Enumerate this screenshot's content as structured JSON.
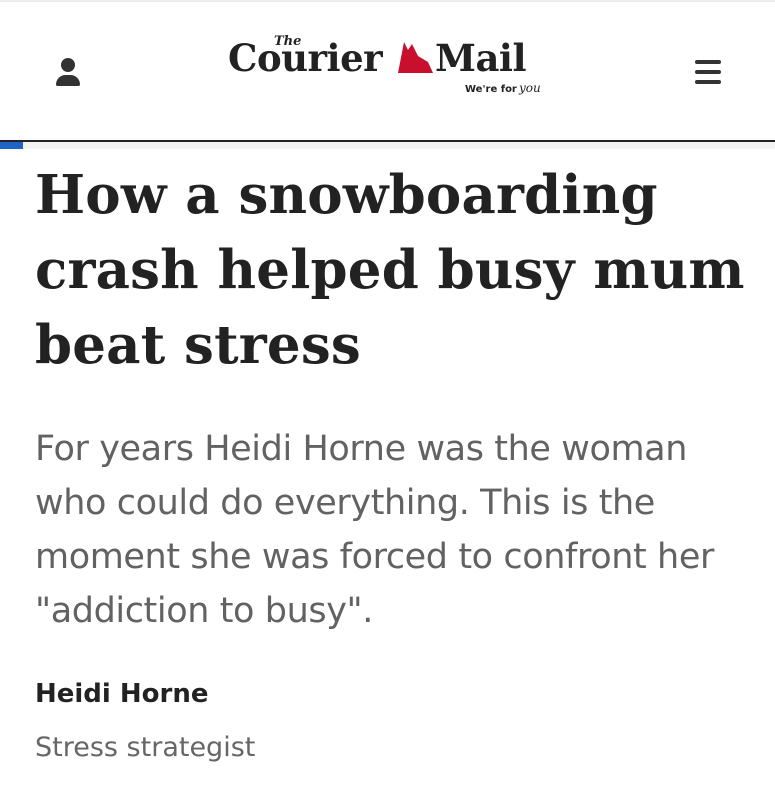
{
  "header": {
    "logo": {
      "the": "The",
      "word1": "Courier",
      "word2": "Mail",
      "tagline_plain": "We're for",
      "tagline_script": "you"
    },
    "reading_progress": 0.03,
    "accent_color": "#1e63c6",
    "logo_map_color": "#c8102e"
  },
  "article": {
    "headline": "How a snowboarding crash helped busy mum beat stress",
    "standfirst": "For years Heidi Horne was the woman who could do everything. This is the moment she was forced to confront her \"addiction to busy\".",
    "author_name": "Heidi Horne",
    "author_title": "Stress strategist"
  }
}
